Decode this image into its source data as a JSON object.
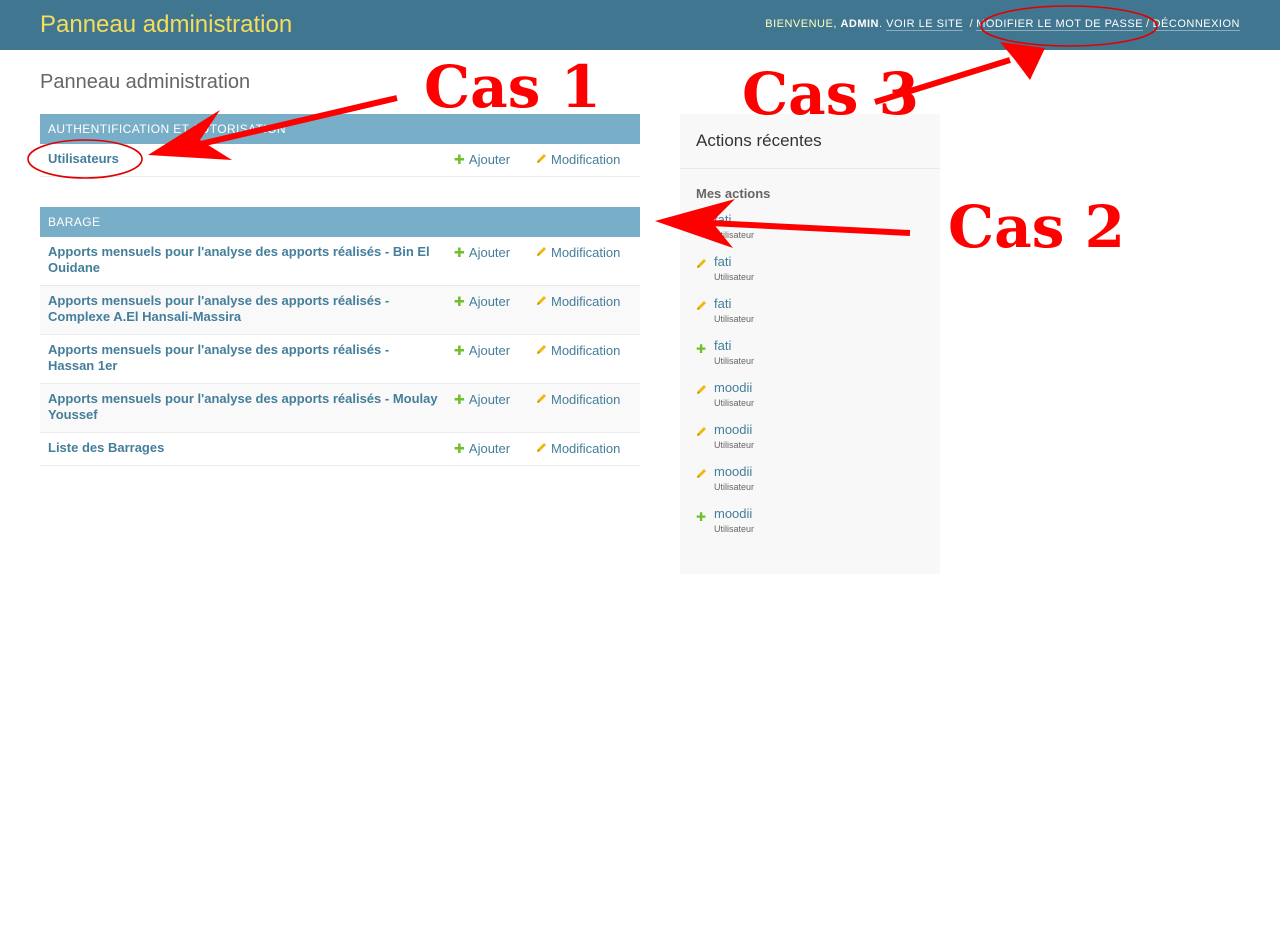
{
  "header": {
    "brand": "Panneau administration",
    "welcome": "Bienvenue,",
    "user_name": "admin",
    "links": [
      "Voir le site",
      "Modifier le mot de passe",
      "Déconnexion"
    ]
  },
  "page": {
    "title": "Panneau administration"
  },
  "modules": [
    {
      "caption": "Authentification et autorisation",
      "rows": [
        {
          "name": "Utilisateurs",
          "add": "Ajouter",
          "change": "Modification"
        }
      ]
    },
    {
      "caption": "Barage",
      "rows": [
        {
          "name": "Apports mensuels pour l'analyse des apports réalisés - Bin El Ouidane",
          "add": "Ajouter",
          "change": "Modification"
        },
        {
          "name": "Apports mensuels pour l'analyse des apports réalisés - Complexe A.El Hansali-Massira",
          "add": "Ajouter",
          "change": "Modification"
        },
        {
          "name": "Apports mensuels pour l'analyse des apports réalisés - Hassan 1er",
          "add": "Ajouter",
          "change": "Modification"
        },
        {
          "name": "Apports mensuels pour l'analyse des apports réalisés - Moulay Youssef",
          "add": "Ajouter",
          "change": "Modification"
        },
        {
          "name": "Liste des Barrages",
          "add": "Ajouter",
          "change": "Modification"
        }
      ]
    }
  ],
  "recent_actions": {
    "title": "Actions récentes",
    "subtitle": "Mes actions",
    "items": [
      {
        "object": "fati",
        "type": "Utilisateur",
        "icon": "pencil-icon"
      },
      {
        "object": "fati",
        "type": "Utilisateur",
        "icon": "pencil-icon"
      },
      {
        "object": "fati",
        "type": "Utilisateur",
        "icon": "pencil-icon"
      },
      {
        "object": "fati",
        "type": "Utilisateur",
        "icon": "plus-icon"
      },
      {
        "object": "moodii",
        "type": "Utilisateur",
        "icon": "pencil-icon"
      },
      {
        "object": "moodii",
        "type": "Utilisateur",
        "icon": "pencil-icon"
      },
      {
        "object": "moodii",
        "type": "Utilisateur",
        "icon": "pencil-icon"
      },
      {
        "object": "moodii",
        "type": "Utilisateur",
        "icon": "plus-icon"
      }
    ]
  },
  "annotations": [
    "Cas 1",
    "Cas 2",
    "Cas 3"
  ],
  "colors": {
    "header_bg": "#417690",
    "brand": "#f5dd5d",
    "caption_bg": "#79aec8",
    "link": "#447e9b",
    "add_green": "#70bf2b",
    "change_yellow": "#efb80b",
    "annotation_red": "#ff0000"
  }
}
